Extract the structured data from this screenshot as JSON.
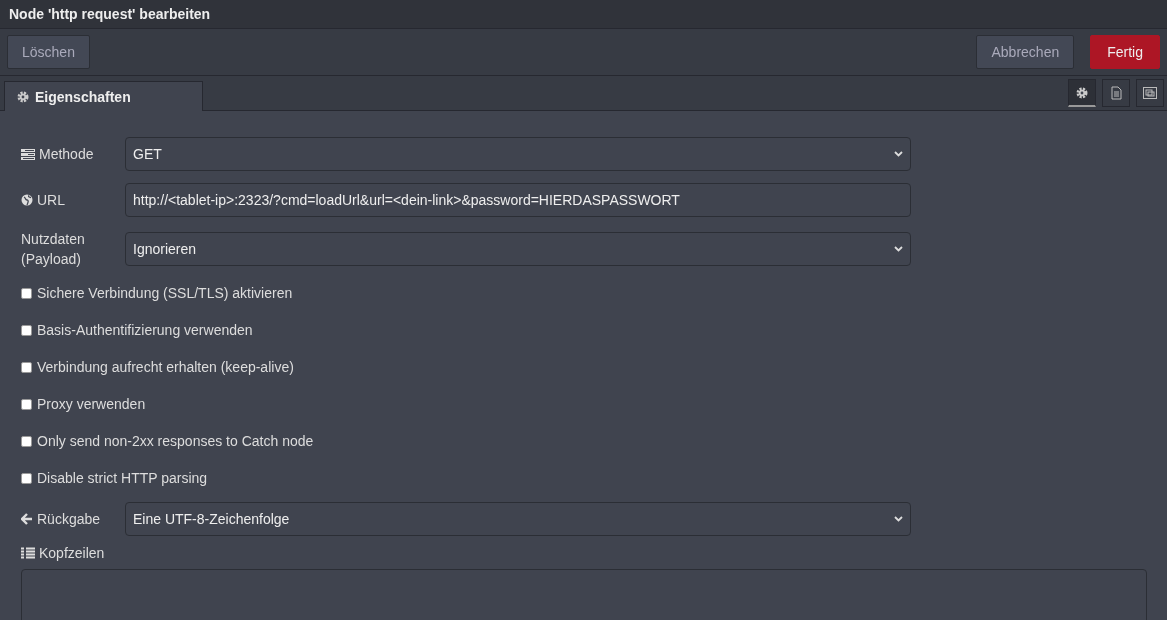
{
  "window": {
    "title": "Node 'http request' bearbeiten"
  },
  "toolbar": {
    "left_buttons": [
      {
        "label": "Löschen",
        "kind": "secondary"
      }
    ],
    "right_buttons": [
      {
        "label": "Abbrechen",
        "kind": "secondary"
      },
      {
        "label": "Fertig",
        "kind": "primary"
      }
    ]
  },
  "tabs": [
    {
      "label": "Eigenschaften",
      "selected": true
    }
  ],
  "side_tabs": [
    {
      "selected": true
    },
    {
      "selected": false
    },
    {
      "selected": false
    }
  ],
  "form": [
    {
      "kind": "select",
      "label": "Methode",
      "value": "GET"
    },
    {
      "kind": "input",
      "label": "URL",
      "value": "http://<tablet-ip>:2323/?cmd=loadUrl&url=<dein-link>&password=HIERDASPASSWORT"
    },
    {
      "kind": "select",
      "label": "Nutzdaten (Payload)",
      "value": "Ignorieren"
    },
    {
      "kind": "checkbox",
      "label": "Sichere Verbindung (SSL/TLS) aktivieren",
      "checked": false
    },
    {
      "kind": "checkbox",
      "label": "Basis-Authentifizierung verwenden",
      "checked": false
    },
    {
      "kind": "checkbox",
      "label": "Verbindung aufrecht erhalten (keep-alive)",
      "checked": false
    },
    {
      "kind": "checkbox",
      "label": "Proxy verwenden",
      "checked": false
    },
    {
      "kind": "checkbox",
      "label": "Only send non-2xx responses to Catch node",
      "checked": false
    },
    {
      "kind": "checkbox",
      "label": "Disable strict HTTP parsing",
      "checked": false
    },
    {
      "kind": "select",
      "label": "Rückgabe",
      "value": "Eine UTF-8-Zeichenfolge"
    },
    {
      "kind": "heading",
      "label": "Kopfzeilen"
    },
    {
      "kind": "textarea"
    }
  ]
}
